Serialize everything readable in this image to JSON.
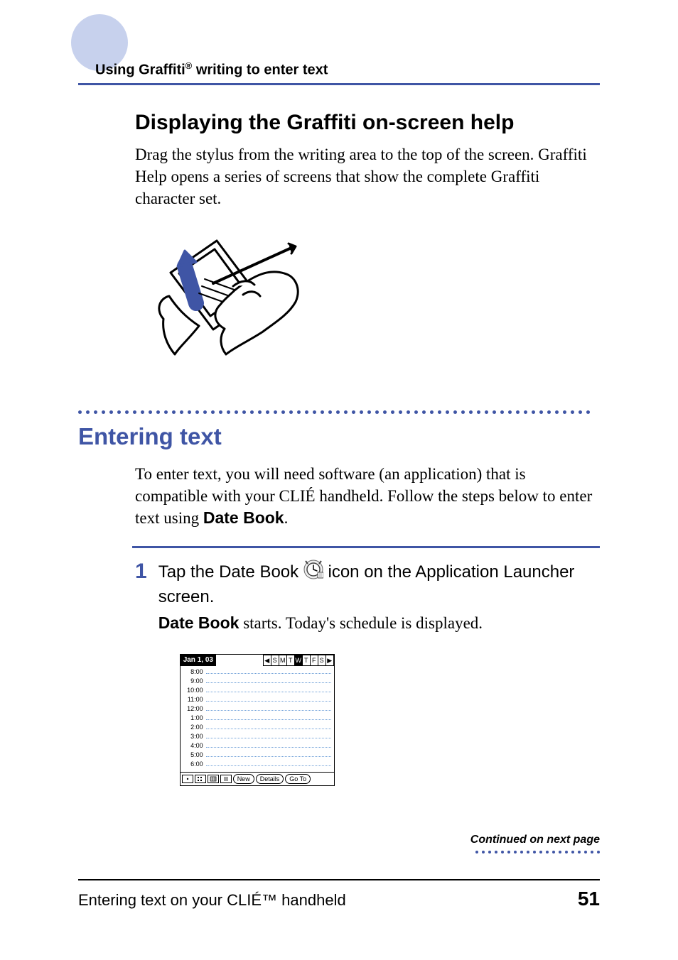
{
  "header": {
    "breadcrumb_prefix": "Using Graffiti",
    "breadcrumb_reg": "®",
    "breadcrumb_suffix": " writing to enter text"
  },
  "section1": {
    "heading": "Displaying the Graffiti on-screen help",
    "body": "Drag the stylus from the writing area to the top of the screen. Graffiti Help opens a series of screens that show the complete Graffiti character set."
  },
  "section2": {
    "heading": "Entering text",
    "intro_prefix": "To enter text, you will need software (an application) that is compatible with your CLIÉ handheld. Follow the steps below to enter text using ",
    "intro_bold": "Date Book",
    "intro_suffix": "."
  },
  "step1": {
    "num": "1",
    "lead_prefix": "Tap the Date Book ",
    "lead_suffix": " icon on the Application Launcher screen.",
    "sub_bold": "Date Book",
    "sub_rest": " starts. Today's schedule is displayed."
  },
  "palm": {
    "date": "Jan 1, 03",
    "arrow_left": "◀",
    "arrow_right": "▶",
    "days": [
      "S",
      "M",
      "T",
      "W",
      "T",
      "F",
      "S"
    ],
    "times": [
      "8:00",
      "9:00",
      "10:00",
      "11:00",
      "12:00",
      "1:00",
      "2:00",
      "3:00",
      "4:00",
      "5:00",
      "6:00"
    ],
    "buttons": {
      "new": "New",
      "details": "Details",
      "goto": "Go To"
    }
  },
  "continued": "Continued on next page",
  "footer": {
    "title": "Entering text on your CLIÉ™ handheld",
    "page": "51"
  }
}
